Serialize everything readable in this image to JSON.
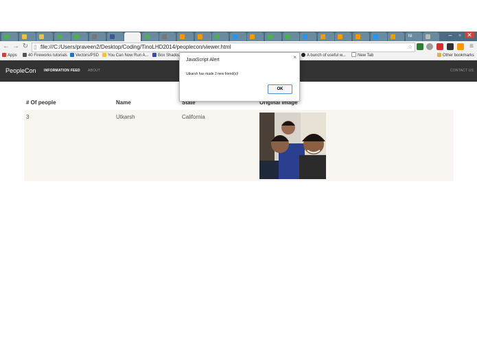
{
  "browser": {
    "url": "file:///C:/Users/praveen2/Desktop/Coding/TinoLHD2014/peoplecon/viewer.html",
    "tab_colors": [
      "#4caf50",
      "#f0c040",
      "#f0c040",
      "#4caf50",
      "#4caf50",
      "#777777",
      "#3b5998",
      "#f2f2f2",
      "#4caf50",
      "#777777",
      "#ff9800",
      "#ff9800",
      "#4caf50",
      "#2196f3",
      "#ff9800",
      "#4caf50",
      "#4caf50",
      "#2196f3",
      "#ff9800",
      "#ff9800",
      "#ff9800",
      "#2196f3",
      "#ff9800",
      "#bbbbbb",
      "#bbbbbb"
    ],
    "tab_short_label": "Ni",
    "bookmarks": {
      "apps": "Apps",
      "items": [
        "40 Fireworks tutorials",
        "Vectors/PSD",
        "You Can Now Run A...",
        "Box Shadow",
        "A bunch of useful w...",
        "New Tab"
      ],
      "other": "Other bookmarks"
    }
  },
  "navbar": {
    "brand": "PeopleCon",
    "links": [
      "INFORMATION FEED",
      "ABOUT"
    ],
    "right_link": "CONTACT US"
  },
  "table": {
    "headers": [
      "# Of people",
      "Name",
      "State",
      "Original Image"
    ],
    "rows": [
      {
        "count": "3",
        "name": "Utkarsh",
        "state": "California"
      }
    ]
  },
  "dialog": {
    "title": "JavaScript Alert",
    "message": "Utkarsh has made 2 new friend(s)!",
    "ok": "OK",
    "close": "×"
  }
}
